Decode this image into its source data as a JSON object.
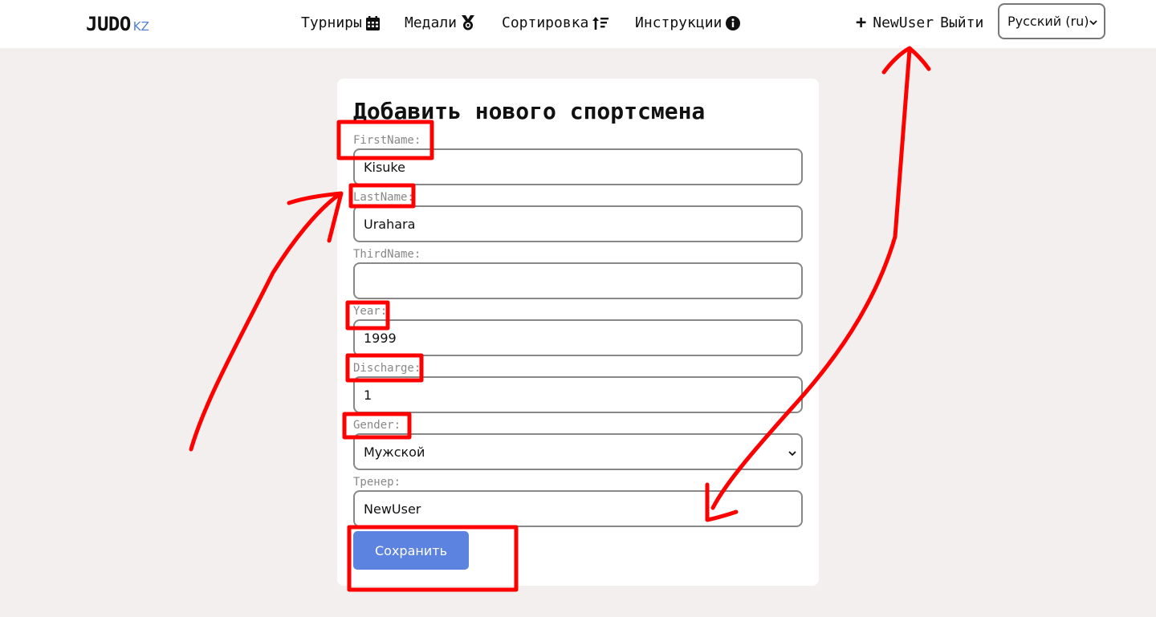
{
  "brand": {
    "main": "JUDO",
    "sub": "KZ"
  },
  "nav": {
    "tournaments": "Турниры",
    "medals": "Медали",
    "sorting": "Сортировка",
    "instructions": "Инструкции"
  },
  "user": {
    "add_icon": "plus-icon",
    "name": "NewUser",
    "logout": "Выйти"
  },
  "language": {
    "selected": "Русский (ru)"
  },
  "form": {
    "title": "Добавить нового спортсмена",
    "fields": {
      "first_name": {
        "label": "FirstName:",
        "value": "Kisuke"
      },
      "last_name": {
        "label": "LastName:",
        "value": "Urahara"
      },
      "third_name": {
        "label": "ThirdName:",
        "value": ""
      },
      "year": {
        "label": "Year:",
        "value": "1999"
      },
      "discharge": {
        "label": "Discharge:",
        "value": "1"
      },
      "gender": {
        "label": "Gender:",
        "value": "Мужской"
      },
      "coach": {
        "label": "Тренер:",
        "value": "NewUser"
      }
    },
    "save": "Сохранить"
  },
  "colors": {
    "page_bg": "#f3efee",
    "brand_accent": "#4f7fd6",
    "primary_button": "#5d83e0",
    "annotation": "#ff0000"
  }
}
